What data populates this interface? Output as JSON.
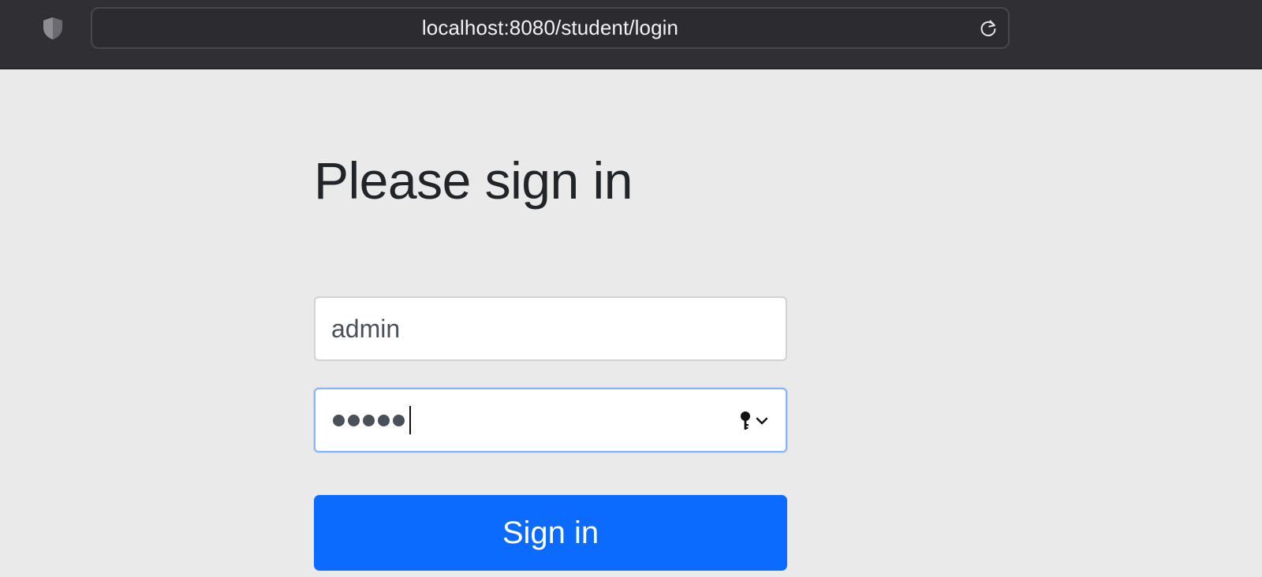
{
  "browser": {
    "url": "localhost:8080/student/login",
    "icons": {
      "privacy": "shield-icon",
      "reload": "reload-icon",
      "password_autofill": "key-icon"
    }
  },
  "login": {
    "heading": "Please sign in",
    "username_value": "admin",
    "password_masked_length": 5,
    "submit_label": "Sign in"
  },
  "colors": {
    "toolbar_bg": "#302f33",
    "page_bg": "#eaeaea",
    "primary": "#0b6bfe",
    "focus_border": "#86b7fe"
  }
}
